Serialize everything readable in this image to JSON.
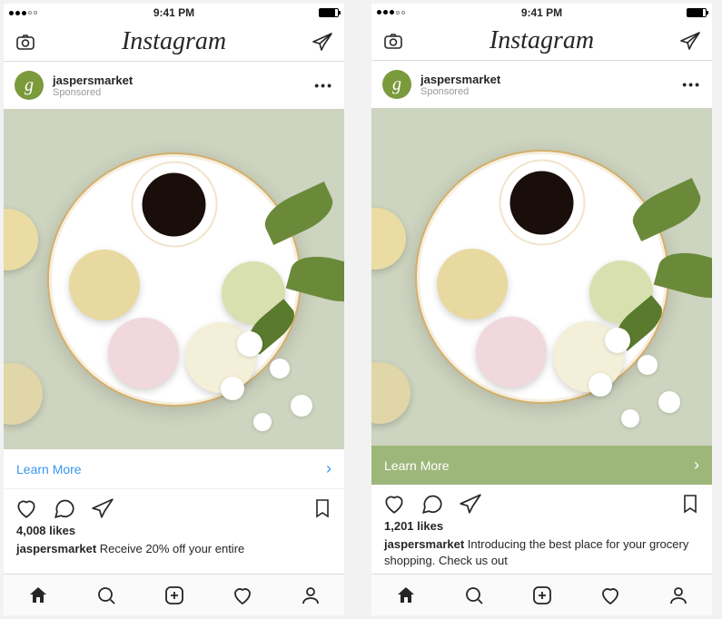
{
  "status_bar": {
    "time": "9:41 PM"
  },
  "app": {
    "name": "Instagram"
  },
  "icons": {
    "camera": "camera-icon",
    "direct": "direct-icon",
    "more": "•••",
    "heart": "heart-icon",
    "comment": "comment-icon",
    "share": "share-icon",
    "bookmark": "bookmark-icon",
    "home": "home-icon",
    "search": "search-icon",
    "add": "add-icon",
    "activity": "activity-icon",
    "profile": "profile-icon"
  },
  "phones": [
    {
      "username": "jaspersmarket",
      "sponsored_label": "Sponsored",
      "cta_label": "Learn More",
      "cta_style": "blue",
      "likes_text": "4,008 likes",
      "caption_user": "jaspersmarket",
      "caption_text": "Receive 20% off your entire"
    },
    {
      "username": "jaspersmarket",
      "sponsored_label": "Sponsored",
      "cta_label": "Learn More",
      "cta_style": "green",
      "likes_text": "1,201 likes",
      "caption_user": "jaspersmarket",
      "caption_text": "Introducing the best place for your grocery shopping. Check us out"
    }
  ]
}
